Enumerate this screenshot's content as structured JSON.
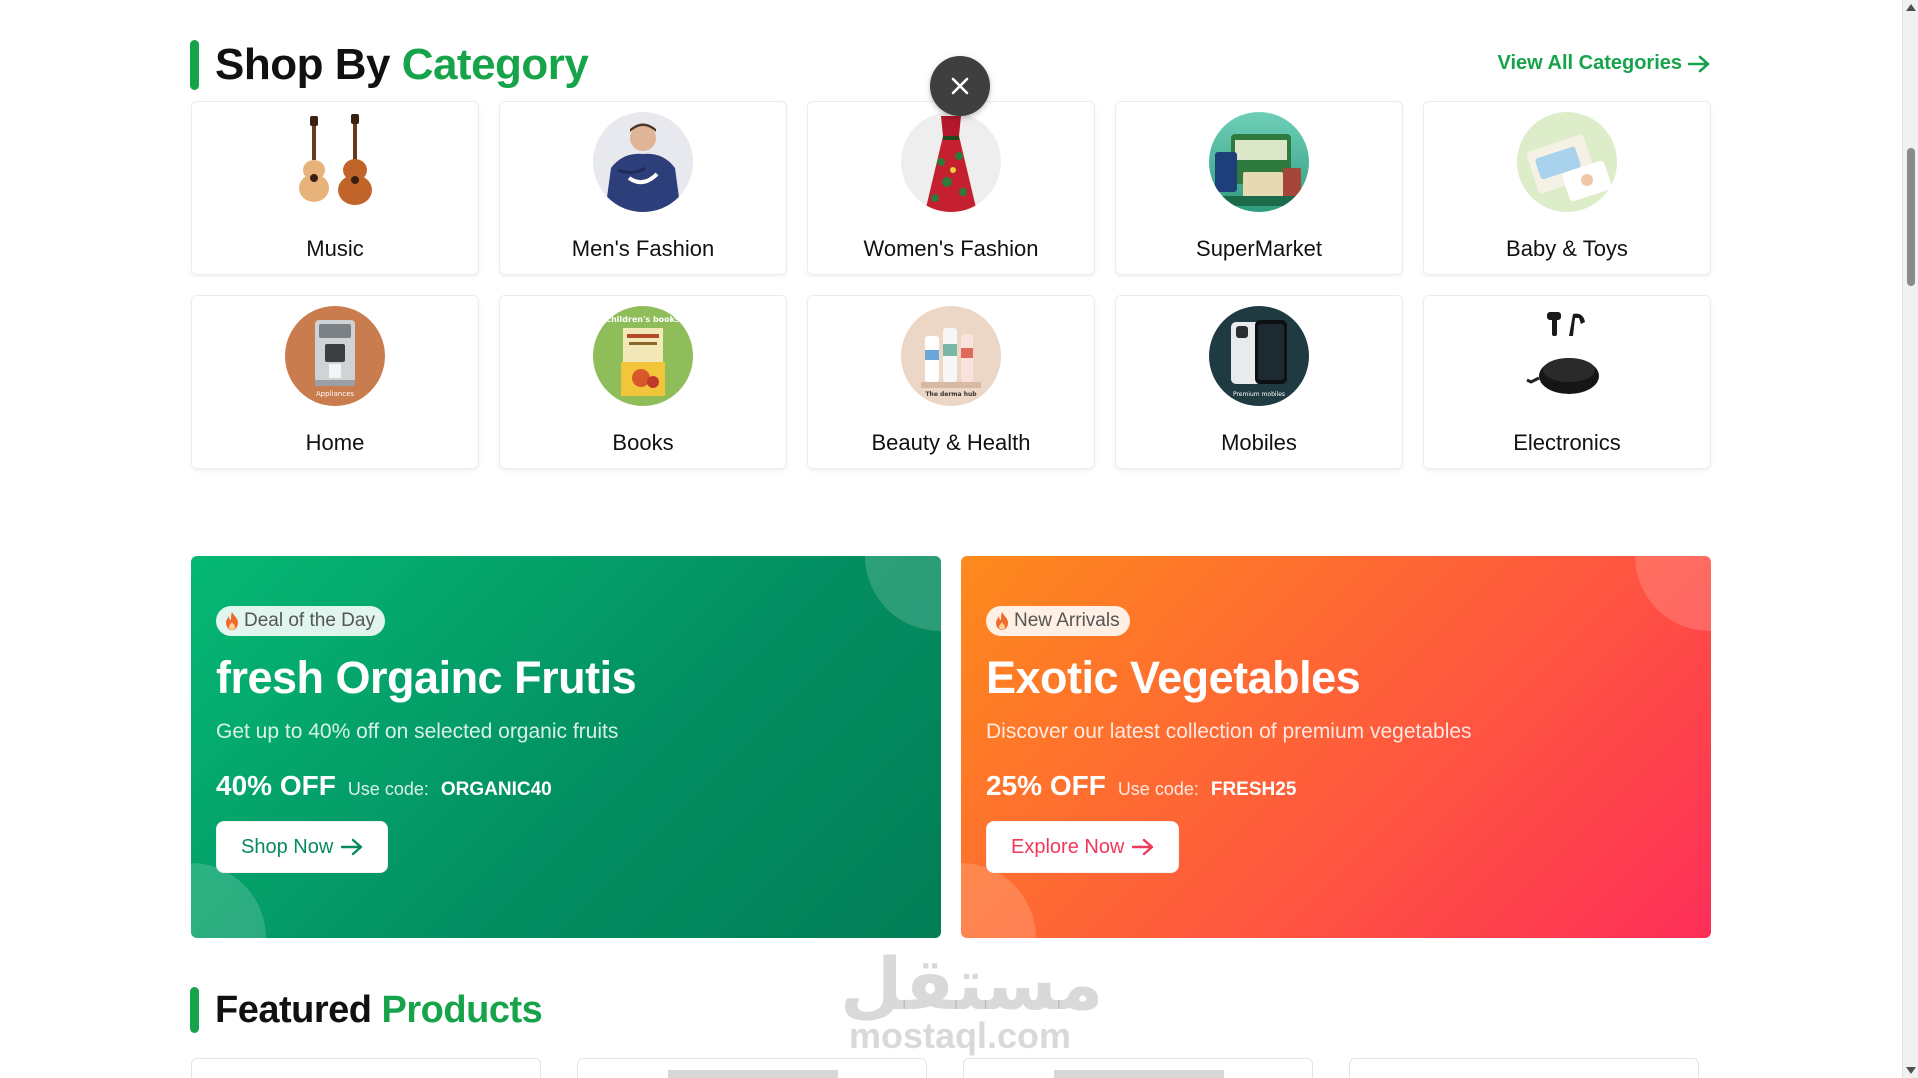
{
  "category_section": {
    "title_dark": "Shop By",
    "title_green": "Category",
    "view_all_label": "View All Categories",
    "items": [
      {
        "label": "Music",
        "icon": "guitar-icon"
      },
      {
        "label": "Men's Fashion",
        "icon": "mens-hoodie-icon"
      },
      {
        "label": "Women's Fashion",
        "icon": "dress-icon"
      },
      {
        "label": "SuperMarket",
        "icon": "groceries-icon"
      },
      {
        "label": "Baby & Toys",
        "icon": "baby-products-icon"
      },
      {
        "label": "Home",
        "icon": "appliance-icon",
        "caption": "Appliances"
      },
      {
        "label": "Books",
        "icon": "books-icon",
        "caption": "children's books"
      },
      {
        "label": "Beauty & Health",
        "icon": "skincare-icon",
        "caption": "The derma hub"
      },
      {
        "label": "Mobiles",
        "icon": "smartphone-icon",
        "caption": "Premium mobiles"
      },
      {
        "label": "Electronics",
        "icon": "earbuds-icon"
      }
    ]
  },
  "promos": [
    {
      "badge": "Deal of the Day",
      "title": "fresh Orgainc Frutis",
      "subtitle": "Get up to 40% off on selected organic fruits",
      "discount": "40% OFF",
      "use_code_label": "Use code:",
      "code": "ORGANIC40",
      "button": "Shop Now",
      "color": "#039062"
    },
    {
      "badge": "New Arrivals",
      "title": "Exotic Vegetables",
      "subtitle": "Discover our latest collection of premium vegetables",
      "discount": "25% OFF",
      "use_code_label": "Use code:",
      "code": "FRESH25",
      "button": "Explore Now",
      "color": "#fe4a48"
    }
  ],
  "featured_section": {
    "title_dark": "Featured",
    "title_green": "Products"
  },
  "watermark": {
    "arabic": "مستقل",
    "latin": "mostaql.com"
  },
  "colors": {
    "brand_green": "#16a34a",
    "close_button": "#3f3f3f"
  }
}
